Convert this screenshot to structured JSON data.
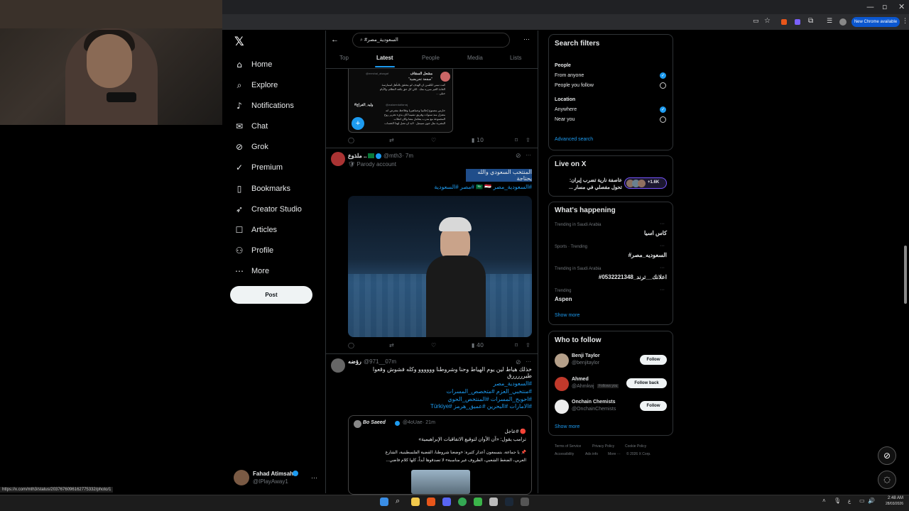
{
  "browser": {
    "new_chrome": "New Chrome available",
    "status_url": "https://x.com/mth3/status/2037676096162775332/photo/1"
  },
  "nav": {
    "items": [
      {
        "label": "Home",
        "icon": "home-icon"
      },
      {
        "label": "Explore",
        "icon": "search-icon"
      },
      {
        "label": "Notifications",
        "icon": "bell-icon"
      },
      {
        "label": "Chat",
        "icon": "chat-icon"
      },
      {
        "label": "Grok",
        "icon": "grok-icon"
      },
      {
        "label": "Premium",
        "icon": "premium-icon"
      },
      {
        "label": "Bookmarks",
        "icon": "bookmark-icon"
      },
      {
        "label": "Creator Studio",
        "icon": "rocket-icon"
      },
      {
        "label": "Articles",
        "icon": "article-icon"
      },
      {
        "label": "Profile",
        "icon": "person-icon"
      },
      {
        "label": "More",
        "icon": "more-icon"
      }
    ],
    "post_label": "Post",
    "account": {
      "name": "Fahad Atimsah",
      "handle": "@IPlayAway1"
    }
  },
  "search": {
    "query": "#السعودية_مصر",
    "tabs": [
      "Top",
      "Latest",
      "People",
      "Media",
      "Lists"
    ],
    "active_tab": "Latest"
  },
  "tweets": [
    {
      "quote_author": "مشعل السقاف",
      "quote_handle": "@meshal_alsagaf",
      "quote_line1": "\"صفعة تحريضية\"",
      "quote_line2": "كنت تمنى لكلسن ان الهدف لم يتحقق بالتأهل لممارسة",
      "quote_line3": "العادة الغير مبرره منك . لكن كل حق بكفه النظام، والأيام",
      "quote_line4": "حبلى ...",
      "reply_author": "#وليد_الفراج",
      "reply_handle": "@walaeedalfarraj",
      "reply_line1": "حارس مصنوع إعلاميا وجماهيريا وفلاحظ مفترض انه",
      "reply_line2": "معتزل منذ سنوات وفريق تشيما كان بذيء تحرير روح",
      "reply_line3": "المجموعة مع مدرب يتعامل معنا وكان انقلاب",
      "reply_line4": "البشرية مثل جون سيبتبل . لابد ان نصل لهذا الحساب",
      "views": "10"
    },
    {
      "author": "ملذوع ..",
      "handle": "@mth3",
      "time": "7m",
      "badge": "Parody account",
      "text": "المنتخب السعودي  والله يحتاجة",
      "tags": "#السعودية_مصر 🇸🇦 🇪🇬 #مصر #السعودية",
      "views": "40"
    },
    {
      "author": "رؤضه",
      "handle": "@971__0",
      "time": "7m",
      "text": "خذلك هياط لين يوم الهياط وحنا وشروطنا وووووو وكله فشوش وقعوا طيرررررق",
      "tags": [
        "#السعودية_مصر",
        "#منتخبي_العزم #متخصص_المسرات",
        "#احوبح_المسرات #المنتخص_الحوي",
        "#الامارات #البحرين #عميق_هرمز #Türkiye"
      ],
      "quote_author": "Bo Saeed",
      "quote_handle": "@4oUae",
      "quote_time": "21m",
      "quote_l1": "🔴 #عاجل",
      "quote_l2": "ترامب يقول: «آن الأوان لتوقيع الاتفاقيات الإبراهيمية»",
      "quote_l3": "📌 يا جماعة، بتسمعون أعذار كثيرة: «وضعنا شروطنا، القضية الفلسطينية، الشارع",
      "quote_l4": "العربي، الضغط الشعبي، الظروف غير مناسبة» لا تصدقوها أبداً، كلها كلام فاضي..."
    }
  ],
  "filters": {
    "title": "Search filters",
    "people_label": "People",
    "people_opts": [
      "From anyone",
      "People you follow"
    ],
    "location_label": "Location",
    "location_opts": [
      "Anywhere",
      "Near you"
    ],
    "advanced": "Advanced search"
  },
  "live": {
    "title": "Live on X",
    "text1": "عاصفة نارية تضرب إيران:",
    "text2": "تحول مفصلي في مسار ...",
    "count": "+1.6K"
  },
  "happening": {
    "title": "What's happening",
    "trends": [
      {
        "meta": "Trending in Saudi Arabia",
        "name": "كاس اسيا"
      },
      {
        "meta": "Sports · Trending",
        "name": "#السعوديه_مصر"
      },
      {
        "meta": "Trending in Saudi Arabia",
        "name": "#اعلانك__ترند_0532221348"
      },
      {
        "meta": "Trending",
        "name": "Aspen"
      }
    ],
    "show_more": "Show more"
  },
  "who_to_follow": {
    "title": "Who to follow",
    "users": [
      {
        "name": "Benji Taylor",
        "handle": "@benjitaylor",
        "button": "Follow",
        "extra": ""
      },
      {
        "name": "Ahmed",
        "handle": "@Ahmkwj",
        "button": "Follow back",
        "extra": "Follows you"
      },
      {
        "name": "Onchain Chemists",
        "handle": "@OnchainChemists",
        "button": "Follow",
        "extra": ""
      }
    ],
    "show_more": "Show more"
  },
  "footer": {
    "links": [
      "Terms of Service",
      "Privacy Policy",
      "Cookie Policy",
      "Accessibility",
      "Ads info",
      "More ···",
      "© 2026 X Corp."
    ]
  },
  "taskbar": {
    "time": "2:48 AM",
    "date": "28/03/2026"
  },
  "colors": {
    "accent": "#1d9bf0",
    "bg": "#000000",
    "border": "#2f3336"
  }
}
